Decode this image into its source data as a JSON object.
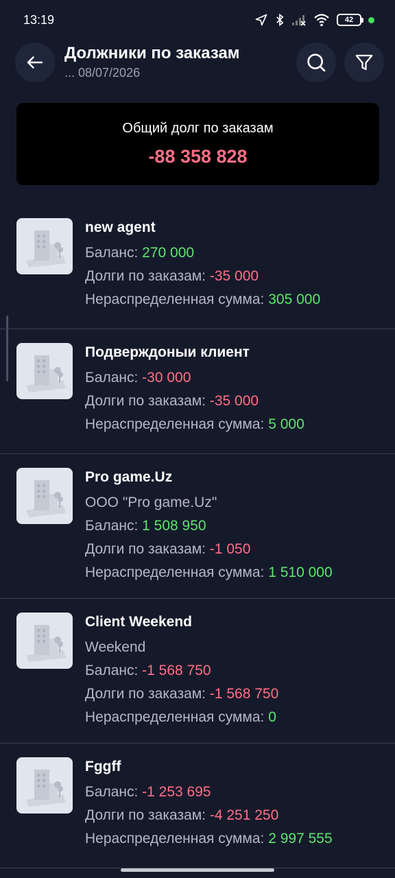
{
  "status": {
    "time": "13:19",
    "battery": "42"
  },
  "header": {
    "title": "Должники по заказам",
    "subtitle": "... 08/07/2026"
  },
  "summary": {
    "label": "Общий долг по заказам",
    "value": "-88 358 828"
  },
  "labels": {
    "balance": "Баланс: ",
    "debt": "Долги по заказам: ",
    "unallocated": "Нераспределенная сумма: "
  },
  "colors": {
    "positive": "#5ee46e",
    "negative": "#ff6f86",
    "background": "#151a2b"
  },
  "clients": [
    {
      "name": "new agent",
      "company": "",
      "balance": "270 000",
      "debt": "-35 000",
      "unallocated": "305 000"
    },
    {
      "name": "Подверждоныи клиент",
      "company": "",
      "balance": "-30 000",
      "debt": "-35 000",
      "unallocated": "5 000"
    },
    {
      "name": "Pro game.Uz",
      "company": "ООО \"Pro game.Uz\"",
      "balance": "1 508 950",
      "debt": "-1 050",
      "unallocated": "1 510 000"
    },
    {
      "name": "Client Weekend",
      "company": "Weekend",
      "balance": "-1 568 750",
      "debt": "-1 568 750",
      "unallocated": "0"
    },
    {
      "name": "Fggff",
      "company": "",
      "balance": "-1 253 695",
      "debt": "-4 251 250",
      "unallocated": "2 997 555"
    }
  ]
}
